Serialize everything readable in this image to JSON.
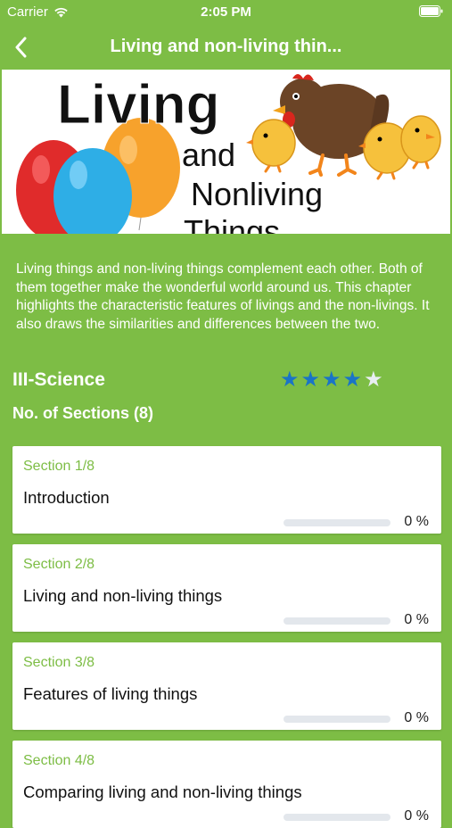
{
  "status_bar": {
    "carrier": "Carrier",
    "time": "2:05 PM"
  },
  "nav": {
    "title": "Living and non-living thin..."
  },
  "hero_image": {
    "line1": "Living",
    "line2": "and",
    "line3": "Nonliving",
    "line4": "Things"
  },
  "description": "Living things and non-living things complement each other. Both of them together make the wonderful world around us. This chapter highlights the characteristic features of livings and the non-livings. It also draws the similarities and differences between the two.",
  "grade": "III-Science",
  "rating": {
    "value": 4,
    "max": 5
  },
  "sections_count": "No. of Sections (8)",
  "sections": [
    {
      "label": "Section 1/8",
      "title": "Introduction",
      "progress": 0,
      "progress_text": "0 %"
    },
    {
      "label": "Section 2/8",
      "title": "Living and non-living things",
      "progress": 0,
      "progress_text": "0 %"
    },
    {
      "label": "Section 3/8",
      "title": "Features of living things",
      "progress": 0,
      "progress_text": "0 %"
    },
    {
      "label": "Section 4/8",
      "title": "Comparing living and non-living things",
      "progress": 0,
      "progress_text": "0 %"
    }
  ],
  "colors": {
    "brand_green": "#7dbd45",
    "star_filled": "#1a74c6",
    "star_empty": "#e8eef2"
  }
}
